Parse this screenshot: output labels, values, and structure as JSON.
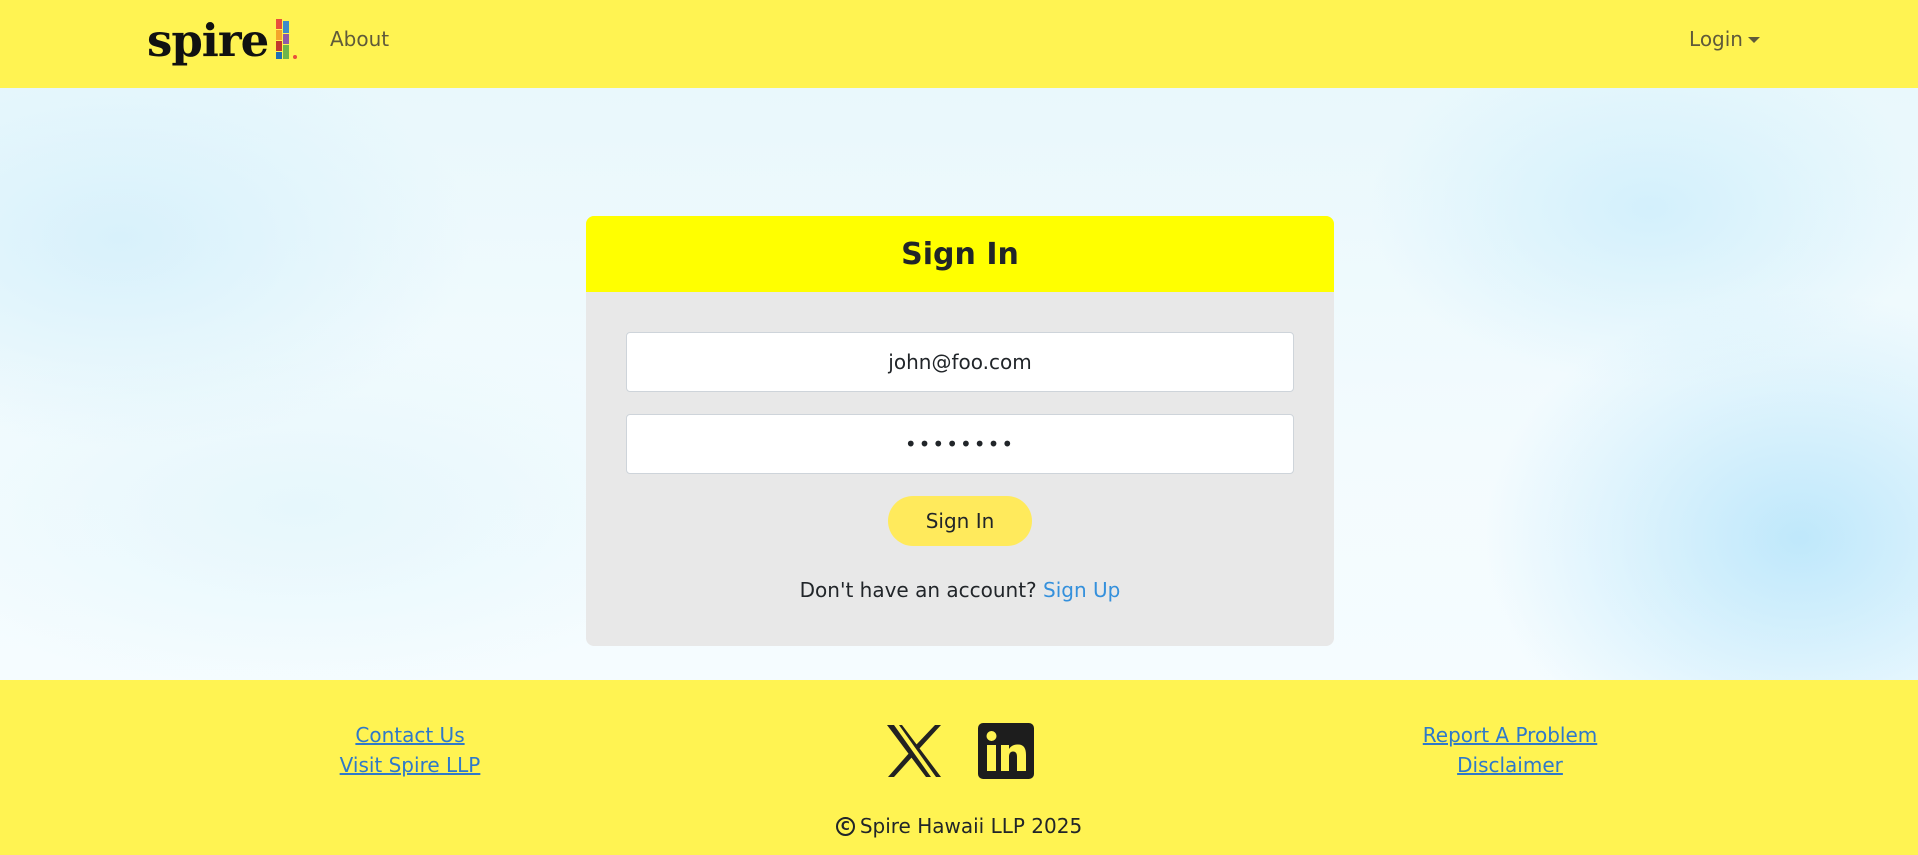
{
  "navbar": {
    "brand": "spire",
    "about_label": "About",
    "login_label": "Login"
  },
  "signin_card": {
    "title": "Sign In",
    "email_value": "john@foo.com",
    "password_value": "••••••••",
    "submit_label": "Sign In",
    "no_account_text": "Don't have an account?",
    "signup_label": "Sign Up"
  },
  "footer": {
    "contact_label": "Contact Us",
    "visit_label": "Visit Spire LLP",
    "report_label": "Report A Problem",
    "disclaimer_label": "Disclaimer",
    "social_icons": [
      "x-icon",
      "linkedin-icon"
    ],
    "copyright_symbol": "C",
    "copyright_text": "Spire Hawaii LLP 2025"
  },
  "colors": {
    "navbar_bg": "#fff352",
    "card_header_bg": "#ffff00",
    "button_bg": "#ffea5c",
    "link": "#3490dc"
  }
}
